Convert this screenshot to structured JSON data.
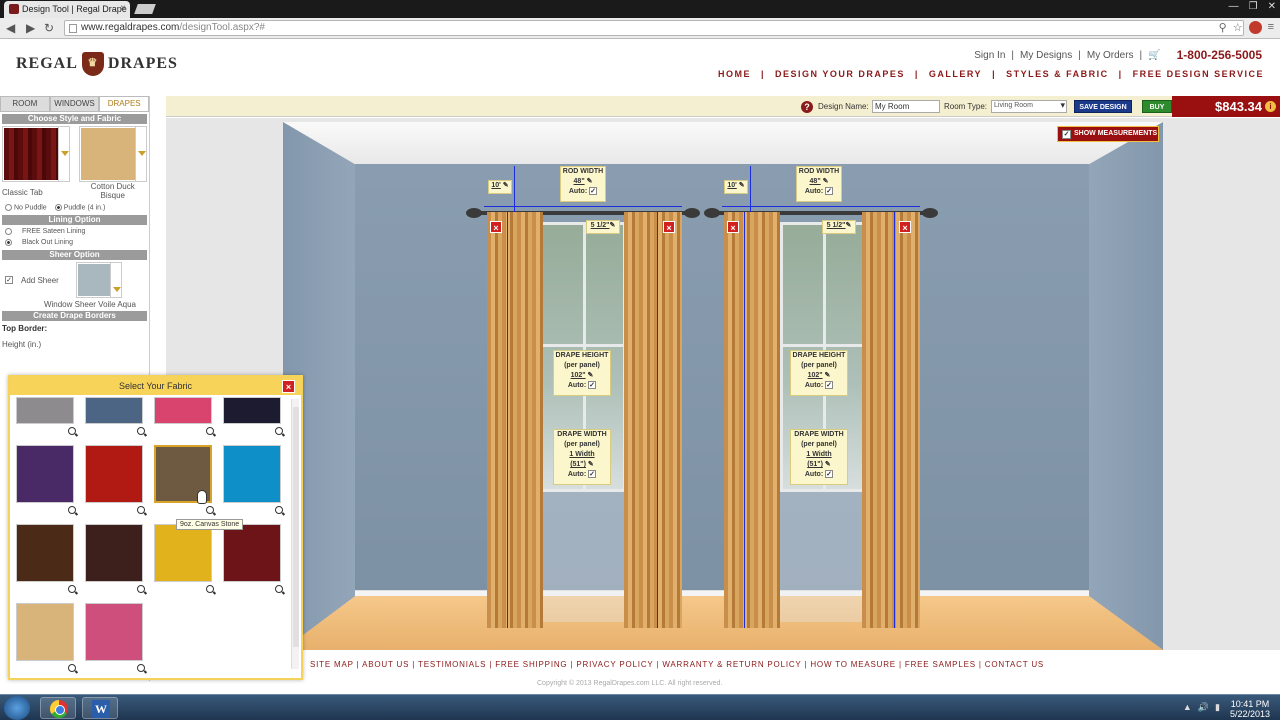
{
  "browser": {
    "tab_title": "Design Tool | Regal Drape",
    "url_host": "www.regaldrapes.com",
    "url_path": "/designTool.aspx?#"
  },
  "site": {
    "logo_left": "REGAL",
    "logo_right": "DRAPES",
    "top_links": [
      "Sign In",
      "My Designs",
      "My Orders"
    ],
    "phone": "1-800-256-5005",
    "nav": [
      "HOME",
      "DESIGN YOUR DRAPES",
      "GALLERY",
      "STYLES & FABRIC",
      "FREE DESIGN SERVICE"
    ]
  },
  "left_panel": {
    "tabs": [
      "ROOM",
      "WINDOWS",
      "DRAPES"
    ],
    "choose_header": "Choose Style and Fabric",
    "style_name": "Classic Tab",
    "fabric_name": "Cotton Duck Bisque",
    "puddle_options": [
      "No Puddle",
      "Puddle (4 in.)"
    ],
    "lining_header": "Lining Option",
    "lining_options": [
      "FREE Sateen Lining",
      "Black Out Lining"
    ],
    "sheer_header": "Sheer Option",
    "add_sheer": "Add Sheer",
    "sheer_name": "Window Sheer Voile Aqua",
    "borders_header": "Create Drape Borders",
    "top_border": "Top Border:",
    "height_label": "Height (in.)"
  },
  "design_bar": {
    "design_name_label": "Design Name:",
    "design_name_value": "My Room",
    "room_type_label": "Room Type:",
    "room_type_value": "Living Room",
    "save_label": "SAVE DESIGN",
    "buy_label": "BUY",
    "price": "$843.34"
  },
  "room": {
    "show_measurements": "SHOW MEASUREMENTS",
    "windows": [
      {
        "rod_height": "10'",
        "rod_width_title": "ROD WIDTH",
        "rod_width": "48\"",
        "auto": "Auto:",
        "return": "5 1/2\"",
        "drape_height_title": "DRAPE HEIGHT",
        "per_panel": "(per panel)",
        "drape_height": "102\"",
        "drape_width_title": "DRAPE WIDTH",
        "drape_width_count": "1 Width",
        "drape_width": "(51\")"
      },
      {
        "rod_height": "10'",
        "rod_width_title": "ROD WIDTH",
        "rod_width": "48\"",
        "auto": "Auto:",
        "return": "5 1/2\"",
        "drape_height_title": "DRAPE HEIGHT",
        "per_panel": "(per panel)",
        "drape_height": "102\"",
        "drape_width_title": "DRAPE WIDTH",
        "drape_width_count": "1 Width",
        "drape_width": "(51\")"
      }
    ]
  },
  "fabric_popup": {
    "title": "Select Your Fabric",
    "tooltip": "9oz. Canvas Stone",
    "swatches": [
      {
        "color": "#8e8b8f"
      },
      {
        "color": "#4d6584"
      },
      {
        "color": "#d9446f"
      },
      {
        "color": "#1d1b30"
      },
      {
        "color": "#4a2a66"
      },
      {
        "color": "#b01a12"
      },
      {
        "color": "#6e5a40",
        "selected": true
      },
      {
        "color": "#0f8fc8"
      },
      {
        "color": "#4b2a18"
      },
      {
        "color": "#3d201c"
      },
      {
        "color": "#e2b21d"
      },
      {
        "color": "#6c1418"
      },
      {
        "color": "#d8b37a"
      },
      {
        "color": "#cf4f7c"
      }
    ]
  },
  "footer": {
    "links": [
      "SITE MAP",
      "ABOUT US",
      "TESTIMONIALS",
      "FREE SHIPPING",
      "PRIVACY POLICY",
      "WARRANTY & RETURN POLICY",
      "HOW TO MEASURE",
      "FREE SAMPLES",
      "CONTACT US"
    ],
    "copyright": "Copyright © 2013 RegalDrapes.com LLC. All right reserved."
  },
  "taskbar": {
    "time": "10:41 PM",
    "date": "5/22/2013"
  }
}
